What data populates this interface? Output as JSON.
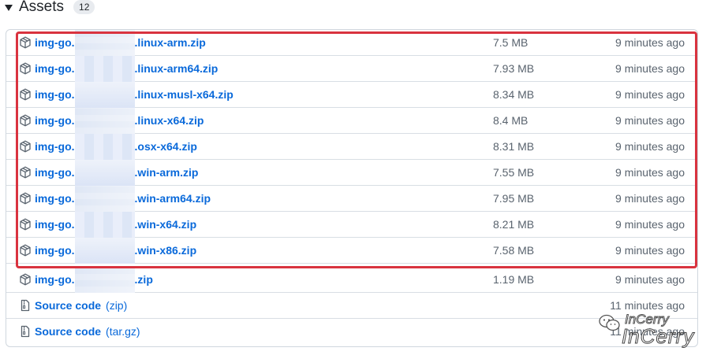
{
  "assets": {
    "title": "Assets",
    "count": "12",
    "rows": [
      {
        "prefix": "img-go.",
        "suffix": ".linux-arm.zip",
        "size": "7.5 MB",
        "time": "9 minutes ago"
      },
      {
        "prefix": "img-go.",
        "suffix": ".linux-arm64.zip",
        "size": "7.93 MB",
        "time": "9 minutes ago"
      },
      {
        "prefix": "img-go.",
        "suffix": ".linux-musl-x64.zip",
        "size": "8.34 MB",
        "time": "9 minutes ago"
      },
      {
        "prefix": "img-go.",
        "suffix": ".linux-x64.zip",
        "size": "8.4 MB",
        "time": "9 minutes ago"
      },
      {
        "prefix": "img-go.",
        "suffix": ".osx-x64.zip",
        "size": "8.31 MB",
        "time": "9 minutes ago"
      },
      {
        "prefix": "img-go.",
        "suffix": ".win-arm.zip",
        "size": "7.55 MB",
        "time": "9 minutes ago"
      },
      {
        "prefix": "img-go.",
        "suffix": ".win-arm64.zip",
        "size": "7.95 MB",
        "time": "9 minutes ago"
      },
      {
        "prefix": "img-go.",
        "suffix": ".win-x64.zip",
        "size": "8.21 MB",
        "time": "9 minutes ago"
      },
      {
        "prefix": "img-go.",
        "suffix": ".win-x86.zip",
        "size": "7.58 MB",
        "time": "9 minutes ago"
      },
      {
        "prefix": "img-go.",
        "suffix": ".zip",
        "size": "1.19 MB",
        "time": "9 minutes ago"
      }
    ],
    "source": [
      {
        "label": "Source code",
        "ext": "(zip)",
        "time": "11 minutes ago"
      },
      {
        "label": "Source code",
        "ext": "(tar.gz)",
        "time": "11 minutes ago"
      }
    ]
  },
  "watermark": {
    "small": "InCerry",
    "big": "InCerry"
  },
  "colors": {
    "link": "#0969da",
    "muted": "#59636e",
    "highlight": "#d9333f",
    "border": "#d0d7de"
  }
}
